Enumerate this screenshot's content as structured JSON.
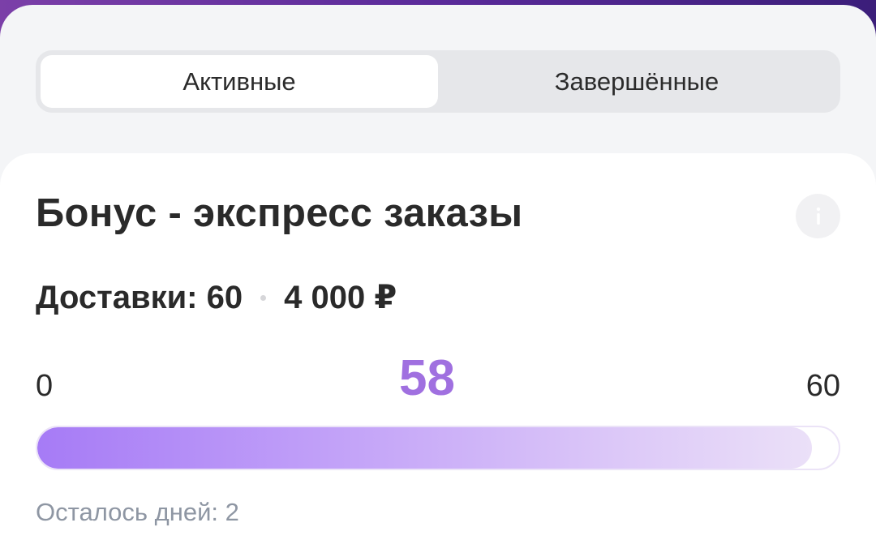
{
  "tabs": [
    {
      "label": "Активные",
      "active": true
    },
    {
      "label": "Завершённые",
      "active": false
    }
  ],
  "bonus": {
    "title": "Бонус - экспресс заказы",
    "deliveries_label": "Доставки: 60",
    "reward": "4 000 ₽",
    "range_min": "0",
    "range_max": "60",
    "current": "58",
    "progress_fraction": 0.9667,
    "days_left": "Осталось дней: 2"
  },
  "colors": {
    "accent": "#a070e0",
    "progress_start": "#a67bf6",
    "progress_end": "#ebe0f8"
  },
  "icons": {
    "info": "info-icon"
  }
}
